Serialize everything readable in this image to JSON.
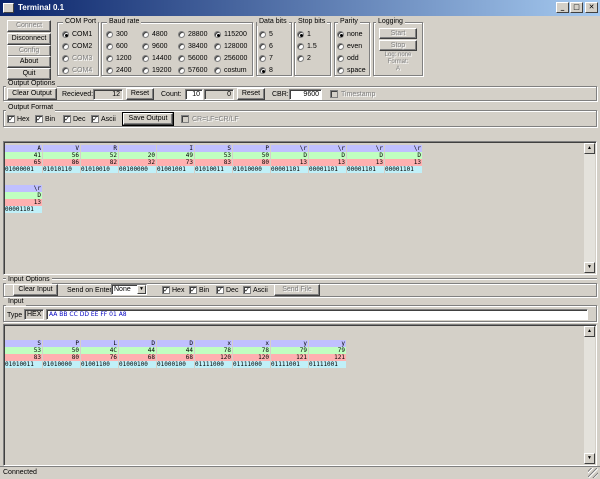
{
  "window": {
    "title": "Terminal 0.1"
  },
  "controls": {
    "connect": "Connect",
    "disconnect": "Disconnect",
    "config": "Config",
    "about": "About",
    "quit": "Quit"
  },
  "com_port": {
    "label": "COM Port",
    "options": [
      "COM1",
      "COM2",
      "COM3",
      "COM4"
    ],
    "selected": "COM1"
  },
  "baud_rate": {
    "label": "Baud rate",
    "options": [
      "300",
      "600",
      "1200",
      "2400",
      "4800",
      "9600",
      "14400",
      "19200",
      "28800",
      "38400",
      "56000",
      "57600",
      "115200",
      "128000",
      "256000",
      "costum"
    ],
    "selected": "115200"
  },
  "data_bits": {
    "label": "Data bits",
    "options": [
      "5",
      "6",
      "7",
      "8"
    ],
    "selected": "8"
  },
  "stop_bits": {
    "label": "Stop bits",
    "options": [
      "1",
      "1.5",
      "2"
    ],
    "selected": "1"
  },
  "parity": {
    "label": "Parity",
    "options": [
      "none",
      "even",
      "odd",
      "space"
    ],
    "selected": "none"
  },
  "logging": {
    "label": "Logging",
    "start": "Start",
    "stop": "Stop",
    "status_line1": "Log: none",
    "status_line2": "Format:",
    "status_line3": "A"
  },
  "output_options": {
    "label": "Output Options",
    "clear": "Clear Output",
    "received_label": "Recieved:",
    "received_value": "12",
    "reset1": "Reset",
    "count_label": "Count:",
    "count_value": "10",
    "count_value2": "0",
    "reset2": "Reset",
    "cbr_label": "CBR:",
    "cbr_value": "9600",
    "timestamp": "Timestamp"
  },
  "output_format": {
    "label": "Output Format",
    "checks": [
      {
        "label": "Hex",
        "checked": true
      },
      {
        "label": "Bin",
        "checked": true
      },
      {
        "label": "Dec",
        "checked": true
      },
      {
        "label": "Ascii",
        "checked": true
      }
    ],
    "save": "Save Output",
    "crlf": "CR=LF=CR/LF"
  },
  "output_bytes": [
    {
      "ascii": "A",
      "hex": "41",
      "dec": "65",
      "bin": "01000001"
    },
    {
      "ascii": "V",
      "hex": "56",
      "dec": "86",
      "bin": "01010110"
    },
    {
      "ascii": "R",
      "hex": "52",
      "dec": "82",
      "bin": "01010010"
    },
    {
      "ascii": " ",
      "hex": "20",
      "dec": "32",
      "bin": "00100000"
    },
    {
      "ascii": "I",
      "hex": "49",
      "dec": "73",
      "bin": "01001001"
    },
    {
      "ascii": "S",
      "hex": "53",
      "dec": "83",
      "bin": "01010011"
    },
    {
      "ascii": "P",
      "hex": "50",
      "dec": "80",
      "bin": "01010000"
    },
    {
      "ascii": "\\r",
      "hex": "D",
      "dec": "13",
      "bin": "00001101"
    },
    {
      "ascii": "\\r",
      "hex": "D",
      "dec": "13",
      "bin": "00001101"
    },
    {
      "ascii": "\\r",
      "hex": "D",
      "dec": "13",
      "bin": "00001101"
    },
    {
      "ascii": "\\r",
      "hex": "D",
      "dec": "13",
      "bin": "00001101"
    },
    {
      "ascii": "\\r",
      "hex": "D",
      "dec": "13",
      "bin": "00001101"
    }
  ],
  "input_options": {
    "label": "Input Options",
    "clear": "Clear Input",
    "send_on_enter_label": "Send on Enter",
    "send_on_enter_value": "None",
    "checks": [
      {
        "label": "Hex",
        "checked": true
      },
      {
        "label": "Bin",
        "checked": true
      },
      {
        "label": "Dec",
        "checked": true
      },
      {
        "label": "Ascii",
        "checked": true
      }
    ],
    "send_file": "Send File"
  },
  "input": {
    "label": "Input",
    "type_label": "Type",
    "type_value": "HEX",
    "text": "AA BB CC DD EE FF 01 A8"
  },
  "input_bytes": [
    {
      "ascii": "S",
      "hex": "53",
      "dec": "83",
      "bin": "01010011"
    },
    {
      "ascii": "P",
      "hex": "50",
      "dec": "80",
      "bin": "01010000"
    },
    {
      "ascii": "L",
      "hex": "4C",
      "dec": "76",
      "bin": "01001100"
    },
    {
      "ascii": "D",
      "hex": "44",
      "dec": "68",
      "bin": "01000100"
    },
    {
      "ascii": "D",
      "hex": "44",
      "dec": "68",
      "bin": "01000100"
    },
    {
      "ascii": "x",
      "hex": "78",
      "dec": "120",
      "bin": "01111000"
    },
    {
      "ascii": "x",
      "hex": "78",
      "dec": "120",
      "bin": "01111000"
    },
    {
      "ascii": "y",
      "hex": "79",
      "dec": "121",
      "bin": "01111001"
    },
    {
      "ascii": "y",
      "hex": "79",
      "dec": "121",
      "bin": "01111001"
    }
  ],
  "status": {
    "text": "Connected"
  }
}
